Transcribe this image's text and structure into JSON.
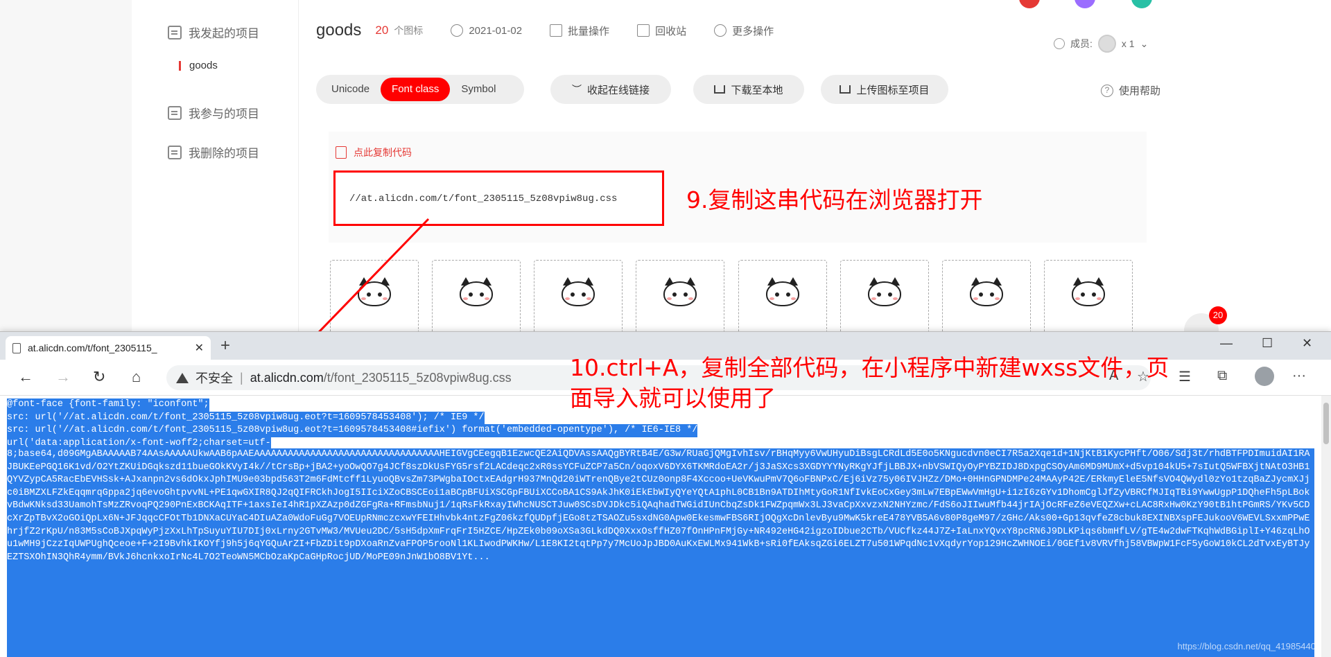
{
  "sidebar": {
    "items": [
      {
        "label": "我发起的项目"
      },
      {
        "label": "我参与的项目"
      },
      {
        "label": "我删除的项目"
      }
    ],
    "active_sub": "goods"
  },
  "project": {
    "title": "goods",
    "icon_count": "20",
    "icon_count_label": "个图标",
    "date": "2021-01-02",
    "batch_label": "批量操作",
    "recycle_label": "回收站",
    "more_label": "更多操作",
    "members_label": "成员:",
    "members_count": "x 1"
  },
  "tabs": [
    "Unicode",
    "Font class",
    "Symbol"
  ],
  "active_tab": "Font class",
  "actions": {
    "collapse_link": "收起在线链接",
    "download": "下载至本地",
    "upload": "上传图标至项目",
    "help": "使用帮助"
  },
  "code_panel": {
    "copy_tip": "点此复制代码",
    "css_url": "//at.alicdn.com/t/font_2305115_5z08vpiw8ug.css"
  },
  "annotations": {
    "step9": "9.复制这串代码在浏览器打开",
    "step10_line1": "10.ctrl+A，复制全部代码，在小程序中新建wxss文件，页",
    "step10_line2": "面导入就可以使用了"
  },
  "badge": "20",
  "browser": {
    "tab_title": "at.alicdn.com/t/font_2305115_",
    "insecure": "不安全",
    "url_host": "at.alicdn.com",
    "url_path": "/t/font_2305115_5z08vpiw8ug.css"
  },
  "code": {
    "line1": "@font-face {font-family: \"iconfont\";",
    "line2": "  src: url('//at.alicdn.com/t/font_2305115_5z08vpiw8ug.eot?t=1609578453408'); /* IE9 */",
    "line3": "  src: url('//at.alicdn.com/t/font_2305115_5z08vpiw8ug.eot?t=1609578453408#iefix') format('embedded-opentype'), /* IE6-IE8 */",
    "line4": "  url('data:application/x-font-woff2;charset=utf-",
    "base64": "8;base64,d09GMgABAAAAAB74AAsAAAAAUkwAAB6pAAEAAAAAAAAAAAAAAAAAAAAAAAAAAAAAAAAAHEIGVgCEegqB1EzwcQE2AiQDVAssAAQgBYRtB4E/G3w/RUaGjQMgIvhIsv/rBHqMyy6VwUHyuDiBsgLCRdLd5E0o5KNgucdvn0eCI7R5a2Xqe1d+1NjKtB1KycPHft/O06/Sdj3t/rhdBTFPDImuidAI1RAJBUKEePGQ16K1vd/O2YtZKUiDGqkszd11bueGOkKVyI4k//tCrsBp+jBA2+yoOwQO7g4JCf8szDkUsFYG5rsf2LACdeqc2xR0ssYCFuZCP7a5Cn/oqoxV6DYX6TKMRdoEA2r/j3JaSXcs3XGDYYYNyRKgYJfjLBBJX+nbVSWIQyOyPYBZIDJ8DxpgCSOyAm6MD9MUmX+d5vp104kU5+7sIutQ5WFBXjtNAtO3HB1QYVZypCA5RacEbEVHSsk+AJxanpn2vs6dOkxJphIMU9e03bpd563T2m6FdMtcff1LyuoQBvsZm73PWgbaIOctxEAdgrH937MnQd20iWTrenQBye2tCUz0onp8F4Xccoo+UeVKwuPmV7Q6oFBNPxC/Ej6iVz75y06IVJHZz/DMo+0HHnGPNDMPe24MAAyP42E/ERkmyEleE5NfsVO4QWydl0zYo1tzqBaZJycmXJjc0iBMZXLFZkEqqmrqGppa2jq6evoGhtpvvNL+PE1qwGXIR8QJ2qQIFRCkhJogI5IIciXZoCBSCEoi1aBCpBFUiXSCGpFBUiXCCoBA1CS9AkJhK0iEkEbWIyQYeYQtA1phL0CB1Bn9ATDIhMtyGoR1NfIvkEoCxGey3mLw7EBpEWwVmHgU+i1zI6zGYv1DhomCglJfZyVBRCfMJIqTBi9YwwUgpP1DQheFh5pLBokvBdwKNksd33UamohTsMzZRvoqPQ290PnExBCKAqITF+1axsIeI4hR1pXZAzp0dZGFgRa+RFmsbNuj1/1qRsFkRxayIWhcNUSCTJuw0SCsDVJDkc5iQAqhadTWGidIUnCbqZsDk1FWZpqmWx3LJ3vaCpXxvzxN2NHYzmc/FdS6oJIIwuMfb44jrIAjOcRFeZ6eVEQZXw+cLAC8RxHw0KzY90tB1htPGmRS/YKv5CDcXrZpTBvX2oGOiQpLx6N+JFJqqcCFOtTb1DNXaCUYaC4DIuAZa0WdoFuGg7VOEUpRNmczcxwYFEIHhvbk4ntzFgZ06kzfQUDpfjEGo8tzTSAOZu5sxdNG0Apw0EkesmwFBS6RIjOQgXcDnlevByu9MwK5kreE478YVB5A6v80P8geM97/zGHc/Aks00+Gp13qvfeZ8cbuk8EXINBXspFEJukooV6WEVLSxxmPPwEhrjfZ2rKpU/n83M5sCoBJXpqWyPjzXxLhTpSuyuYIU7DIj0xLrny2GTvMW3/MVUeu2DC/5sH5dpXmFrqFrI5HZCE/HpZEk0b09oXSa3GLkdDQ0XxxOsffHZ07fOnHPnFMjGy+NR492eHG42igzoIDbue2CTb/VUCfkz44J7Z+IaLnxYQvxY8pcRN6J9DLKPiqs6bmHfLV/gTE4w2dwFTKqhWdBGiplI+Y46zqLhOu1wMH9jCzzIqUWPUghQceoe+F+2I9BvhkIKOYfj9h5j6qYGQuArZI+FbZDit9pDXoaRnZvaFPOP5rooNl1KLIwodPWKHw/L1E8KI2tqtPp7y7McUoJpJBD0AuKxEWLMx941WkB+sRi0fEAksqZGi6ELZT7u501WPqdNc1vXqdyrYop129HcZWHNOEi/0GEf1v8VRVfhj58VBWpW1FcF5yGoW10kCL2dTvxEyBTJyEZTSXOhIN3QhR4ymm/BVkJ6hcnkxoIrNc4L7O2TeoWN5MCbOzaKpCaGHpRocjUD/MoPE09nJnW1bO8BV1Yt..."
  },
  "watermark": "https://blog.csdn.net/qq_41985440"
}
